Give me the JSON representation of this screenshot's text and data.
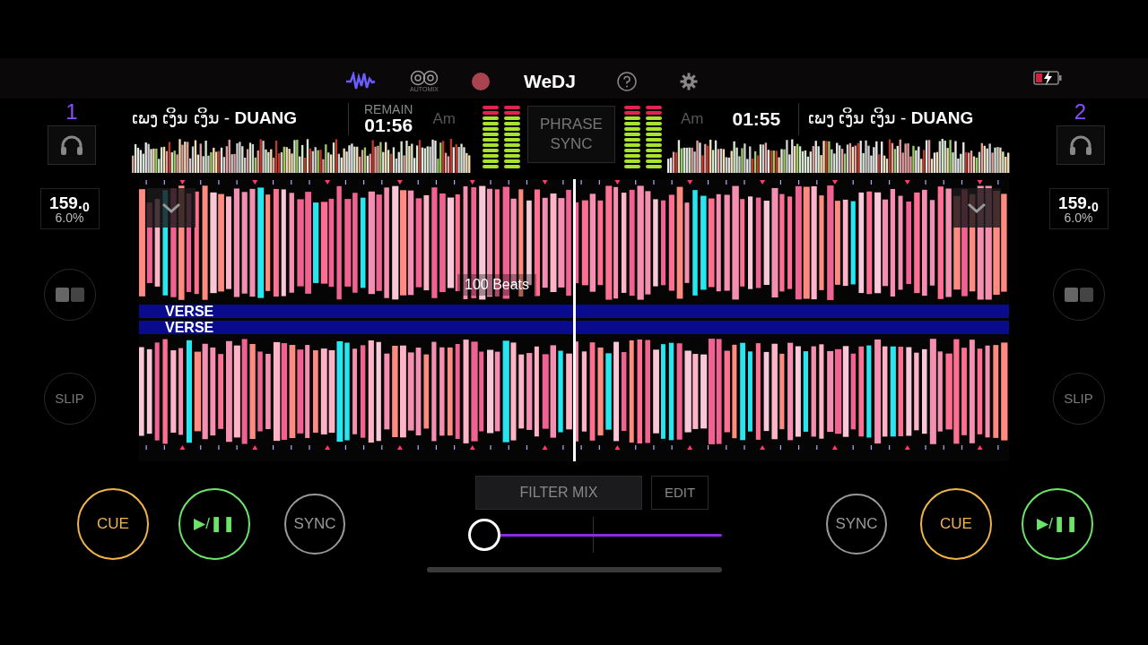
{
  "toolbar": {
    "logo": "WeDJ",
    "automix_label": "AUTOMIX"
  },
  "decks": [
    {
      "number": "1",
      "title": "ເພງ ເງິນ ເງິນ - **DUANG**",
      "time_label": "REMAIN",
      "time": "01:56",
      "key": "Am",
      "bpm": "159.$_{0}$",
      "pitch": "6.0%",
      "slip": "SLIP",
      "cue": "CUE",
      "play": "▶/❚❚",
      "sync": "SYNC",
      "section": "VERSE",
      "meters": [
        {
          "level": 1
        },
        {
          "level": 1
        }
      ]
    },
    {
      "number": "2",
      "title": "ເພງ ເງິນ ເງິນ - **DUANG**",
      "time": "01:55",
      "key": "Am",
      "bpm": "159.$_{0}$",
      "pitch": "6.0%",
      "slip": "SLIP",
      "cue": "CUE",
      "play": "▶/❚❚",
      "sync": "SYNC",
      "section": "VERSE",
      "meters": [
        {
          "level": 1
        },
        {
          "level": 1
        }
      ]
    }
  ],
  "phrase_sync": "PHRASE SYNC",
  "beat_counter": "100 Beats",
  "mixer": {
    "mode": "FILTER MIX",
    "edit": "EDIT",
    "crossfader": {
      "level": 0.05
    }
  }
}
